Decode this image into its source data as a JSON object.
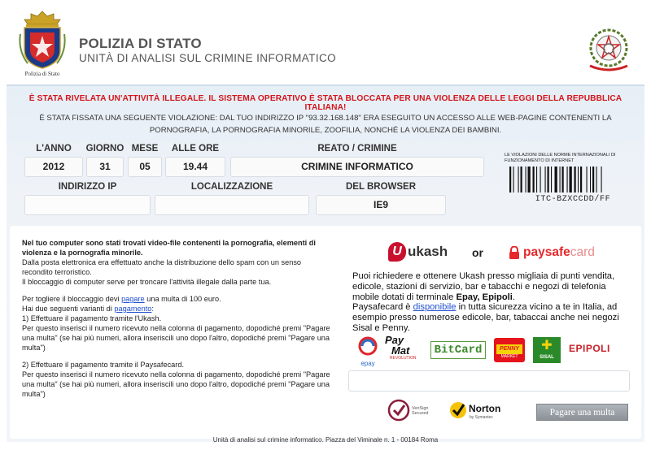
{
  "header": {
    "left_logo_caption": "Polizia di Stato",
    "org_title": "POLIZIA DI STATO",
    "org_subtitle": "UNITÀ DI ANALISI SUL CRIMINE INFORMATICO"
  },
  "alert": {
    "headline": "È STATA RIVELATA UN'ATTIVITÀ ILLEGALE. IL SISTEMA OPERATIVO È STATA BLOCCATA PER UNA VIOLENZA DELLE LEGGI DELLA REPUBBLICA ITALIANA!",
    "line1": "È STATA FISSATA UNA SEGUENTE VIOLAZIONE: DAL TUO INDIRIZZO IP \"93.32.168.148\" ERA ESEGUITO UN ACCESSO ALLE WEB-PAGINE CONTENENTI LA",
    "line2": "PORNOGRAFIA, LA PORNOGRAFIA MINORILE, ZOOFILIA, NONCHÉ LA VIOLENZA DEI BAMBINI."
  },
  "info": {
    "year_label": "L'ANNO",
    "year": "2012",
    "day_label": "GIORNO",
    "day": "31",
    "month_label": "MESE",
    "month": "05",
    "time_label": "ALLE ORE",
    "time": "19.44",
    "crime_label": "REATO / CRIMINE",
    "crime": "CRIMINE INFORMATICO",
    "ip_label": "INDIRIZZO IP",
    "ip": "",
    "location_label": "LOCALIZZAZIONE",
    "location": "",
    "browser_label": "DEL BROWSER",
    "browser": "IE9"
  },
  "barcode": {
    "title": "LE VIOLAZIONI DELLE NORME INTERNAZIONALI DI FUNZIONAMENTO DI INTERNET",
    "code": "ITC-BZXCCDD/FF"
  },
  "left": {
    "p1": "Nel tuo computer sono stati trovati video-file contenenti la pornografia, elementi di violenza e la pornografia minorile.",
    "p2": "Dalla posta elettronica era effettuato anche la distribuzione dello spam con un senso recondito terroristico.",
    "p3": "Il bloccaggio di computer serve per troncare l'attività illegale dalla parte tua.",
    "p4_pre": "Per togliere il bloccaggio devi ",
    "p4_link": "pagare",
    "p4_post": " una multa di 100 euro.",
    "p5_pre": "Hai due seguenti varianti di ",
    "p5_link": "pagamento",
    "p5_post": ":",
    "opt1_title": "1) Effettuare il pagamento tramite l'Ukash.",
    "opt1_text": "Per questo inserisci il numero ricevuto nella colonna di pagamento, dopodiché premi \"Pagare una multa\" (se hai più numeri, allora inseriscili uno dopo l'altro, dopodiché premi \"Pagare una multa\")",
    "opt2_title": "2) Effettuare il pagamento tramite il Paysafecard.",
    "opt2_text": "Per questo inserisci il numero ricevuto nella colonna di pagamento, dopodiché premi \"Pagare una multa\" (se hai più numeri, allora inseriscili uno dopo l'altro, dopodiché premi \"Pagare una multa\")"
  },
  "right": {
    "ukash_logo": "ukash",
    "or": "or",
    "psc_logo_a": "paysafe",
    "psc_logo_b": "card",
    "ukash_text_pre": "Puoi richiedere e ottenere Ukash presso migliaia di punti vendita, edicole, stazioni di servizio, bar e tabacchi e negozi di telefonia mobile dotati di terminale ",
    "ukash_text_bold": "Epay, Epipoli",
    "ukash_text_post": ".",
    "psc_text_pre": "Paysafecard è ",
    "psc_text_link": "disponibile",
    "psc_text_post": " in tutta sicurezza vicino a te in Italia, ad esempio presso numerose edicole, bar, tabaccai anche nei negozi Sisal e Penny.",
    "logo_epay": "epay",
    "logo_paymat_a": "Pay",
    "logo_paymat_b": "Mat",
    "logo_paymat_c": "REVOLUTION",
    "logo_bitcard": "BitCard",
    "logo_penny": "PENNY",
    "logo_penny_sub": "MARKET",
    "logo_sisal": "SISAL",
    "logo_epipoli": "EPIPOLI",
    "seal_verisign_a": "VeriSign",
    "seal_verisign_b": "Secured",
    "seal_norton": "Norton",
    "seal_norton_sub": "by Symantec",
    "pay_button": "Pagare una multa"
  },
  "footer": {
    "text": "Unità di analisi sul crimine informatico. Piazza del Viminale n. 1 - 00184 Roma"
  }
}
